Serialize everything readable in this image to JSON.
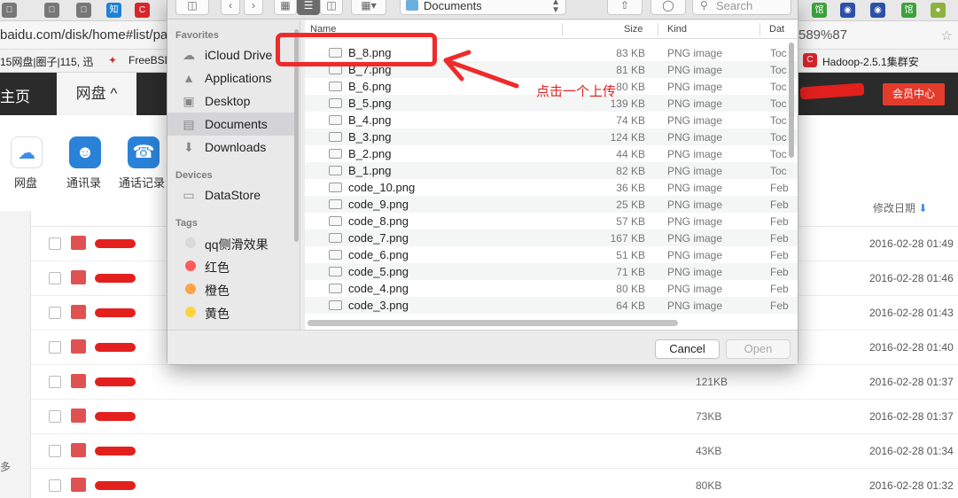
{
  "browser": {
    "url_text": "baidu.com/disk/home#list/pat",
    "url_tail": "589%87",
    "bookmarks": [
      "15网盘|圈子|115, 迅",
      "FreeBSD",
      "Hadoop-2.5.1集群安"
    ]
  },
  "baidu": {
    "nav_home": "主页",
    "nav_pan": "网盘 ^",
    "vip_button": "会员中心",
    "apps": [
      {
        "label": "网盘",
        "icon": "cloud-icon"
      },
      {
        "label": "通讯录",
        "icon": "contacts-icon"
      },
      {
        "label": "通话记录",
        "icon": "call-log-icon"
      }
    ],
    "sort_header": "修改日期",
    "rows": [
      {
        "size": "",
        "date": "2016-02-28 01:49"
      },
      {
        "size": "",
        "date": "2016-02-28 01:46"
      },
      {
        "size": "",
        "date": "2016-02-28 01:43"
      },
      {
        "size": "",
        "date": "2016-02-28 01:40"
      },
      {
        "size": "121KB",
        "date": "2016-02-28 01:37"
      },
      {
        "size": "73KB",
        "date": "2016-02-28 01:37"
      },
      {
        "size": "43KB",
        "date": "2016-02-28 01:34"
      },
      {
        "size": "80KB",
        "date": "2016-02-28 01:32"
      }
    ],
    "left_more": "多"
  },
  "dialog": {
    "location": "Documents",
    "search_placeholder": "Search",
    "sidebar": {
      "favorites_header": "Favorites",
      "favorites": [
        "iCloud Drive",
        "Applications",
        "Desktop",
        "Documents",
        "Downloads"
      ],
      "devices_header": "Devices",
      "devices": [
        "DataStore"
      ],
      "tags_header": "Tags",
      "tags": [
        {
          "label": "qq侧滑效果",
          "color": "#d9d9d9"
        },
        {
          "label": "红色",
          "color": "#ff5a5a"
        },
        {
          "label": "橙色",
          "color": "#ffa347"
        },
        {
          "label": "黄色",
          "color": "#ffd340"
        }
      ]
    },
    "columns": {
      "name": "Name",
      "size": "Size",
      "kind": "Kind",
      "date": "Dat"
    },
    "files": [
      {
        "name": "B_8.png",
        "size": "83 KB",
        "kind": "PNG image",
        "date": "Toc"
      },
      {
        "name": "B_7.png",
        "size": "81 KB",
        "kind": "PNG image",
        "date": "Toc"
      },
      {
        "name": "B_6.png",
        "size": "80 KB",
        "kind": "PNG image",
        "date": "Toc"
      },
      {
        "name": "B_5.png",
        "size": "139 KB",
        "kind": "PNG image",
        "date": "Toc"
      },
      {
        "name": "B_4.png",
        "size": "74 KB",
        "kind": "PNG image",
        "date": "Toc"
      },
      {
        "name": "B_3.png",
        "size": "124 KB",
        "kind": "PNG image",
        "date": "Toc"
      },
      {
        "name": "B_2.png",
        "size": "44 KB",
        "kind": "PNG image",
        "date": "Toc"
      },
      {
        "name": "B_1.png",
        "size": "82 KB",
        "kind": "PNG image",
        "date": "Toc"
      },
      {
        "name": "code_10.png",
        "size": "36 KB",
        "kind": "PNG image",
        "date": "Feb"
      },
      {
        "name": "code_9.png",
        "size": "25 KB",
        "kind": "PNG image",
        "date": "Feb"
      },
      {
        "name": "code_8.png",
        "size": "57 KB",
        "kind": "PNG image",
        "date": "Feb"
      },
      {
        "name": "code_7.png",
        "size": "167 KB",
        "kind": "PNG image",
        "date": "Feb"
      },
      {
        "name": "code_6.png",
        "size": "51 KB",
        "kind": "PNG image",
        "date": "Feb"
      },
      {
        "name": "code_5.png",
        "size": "71 KB",
        "kind": "PNG image",
        "date": "Feb"
      },
      {
        "name": "code_4.png",
        "size": "80 KB",
        "kind": "PNG image",
        "date": "Feb"
      },
      {
        "name": "code_3.png",
        "size": "64 KB",
        "kind": "PNG image",
        "date": "Feb"
      }
    ],
    "cancel_label": "Cancel",
    "open_label": "Open"
  },
  "annotation": {
    "text": "点击一个上传",
    "color": "#e22020"
  }
}
